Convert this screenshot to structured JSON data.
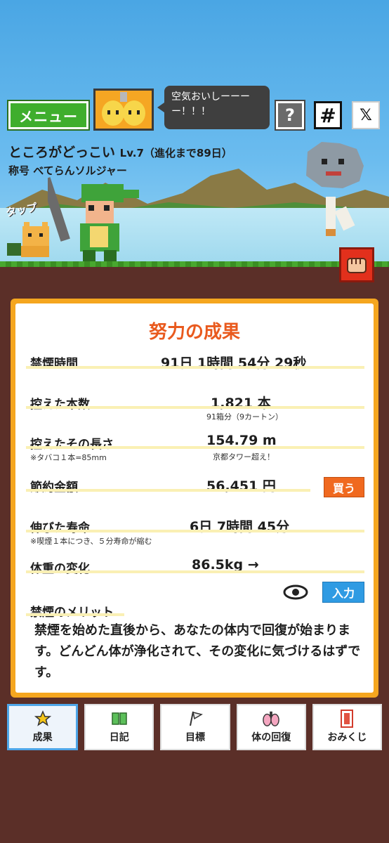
{
  "header": {
    "menu_label": "メニュー",
    "speech_text": "空気おいしーーーー！！！",
    "help_label": "?",
    "hash_label": "#",
    "x_label": "𝕏"
  },
  "player": {
    "name": "ところがどっこい",
    "level": "Lv.7（進化まで89日）",
    "title": "称号  べてらんソルジャー",
    "tap_label": "タップ"
  },
  "results": {
    "title": "努力の成果",
    "rows": [
      {
        "label": "禁煙時間",
        "value": "91日  1時間  54分  29秒"
      },
      {
        "label": "控えた本数",
        "value": "1,821 本",
        "sub": "91箱分（9カートン）"
      },
      {
        "label": "控えたその長さ",
        "value": "154.79  m",
        "sub": "京都タワー超え！",
        "note": "※タバコ１本=85mm"
      },
      {
        "label": "節約金額",
        "value": "56,451 円",
        "button": "買う"
      },
      {
        "label": "伸びた寿命",
        "value": "6日  7時間  45分",
        "note": "※喫煙１本につき、５分寿命が縮む"
      },
      {
        "label": "体重の変化",
        "value": "86.5kg  →",
        "button": "入力"
      }
    ],
    "merit_title": "禁煙のメリット",
    "merit_text": "禁煙を始めた直後から、あなたの体内で回復が始まります。どんどん体が浄化されて、その変化に気づけるはずです。"
  },
  "nav": {
    "items": [
      {
        "label": "成果",
        "icon": "star-icon",
        "active": true
      },
      {
        "label": "日記",
        "icon": "book-icon"
      },
      {
        "label": "目標",
        "icon": "flag-icon"
      },
      {
        "label": "体の回復",
        "icon": "lungs-icon"
      },
      {
        "label": "おみくじ",
        "icon": "omikuji-icon"
      }
    ]
  },
  "colors": {
    "accent": "#e95a1e",
    "panel_border": "#f5a61f",
    "menu_green": "#3fae2d",
    "input_blue": "#2f9be3"
  }
}
